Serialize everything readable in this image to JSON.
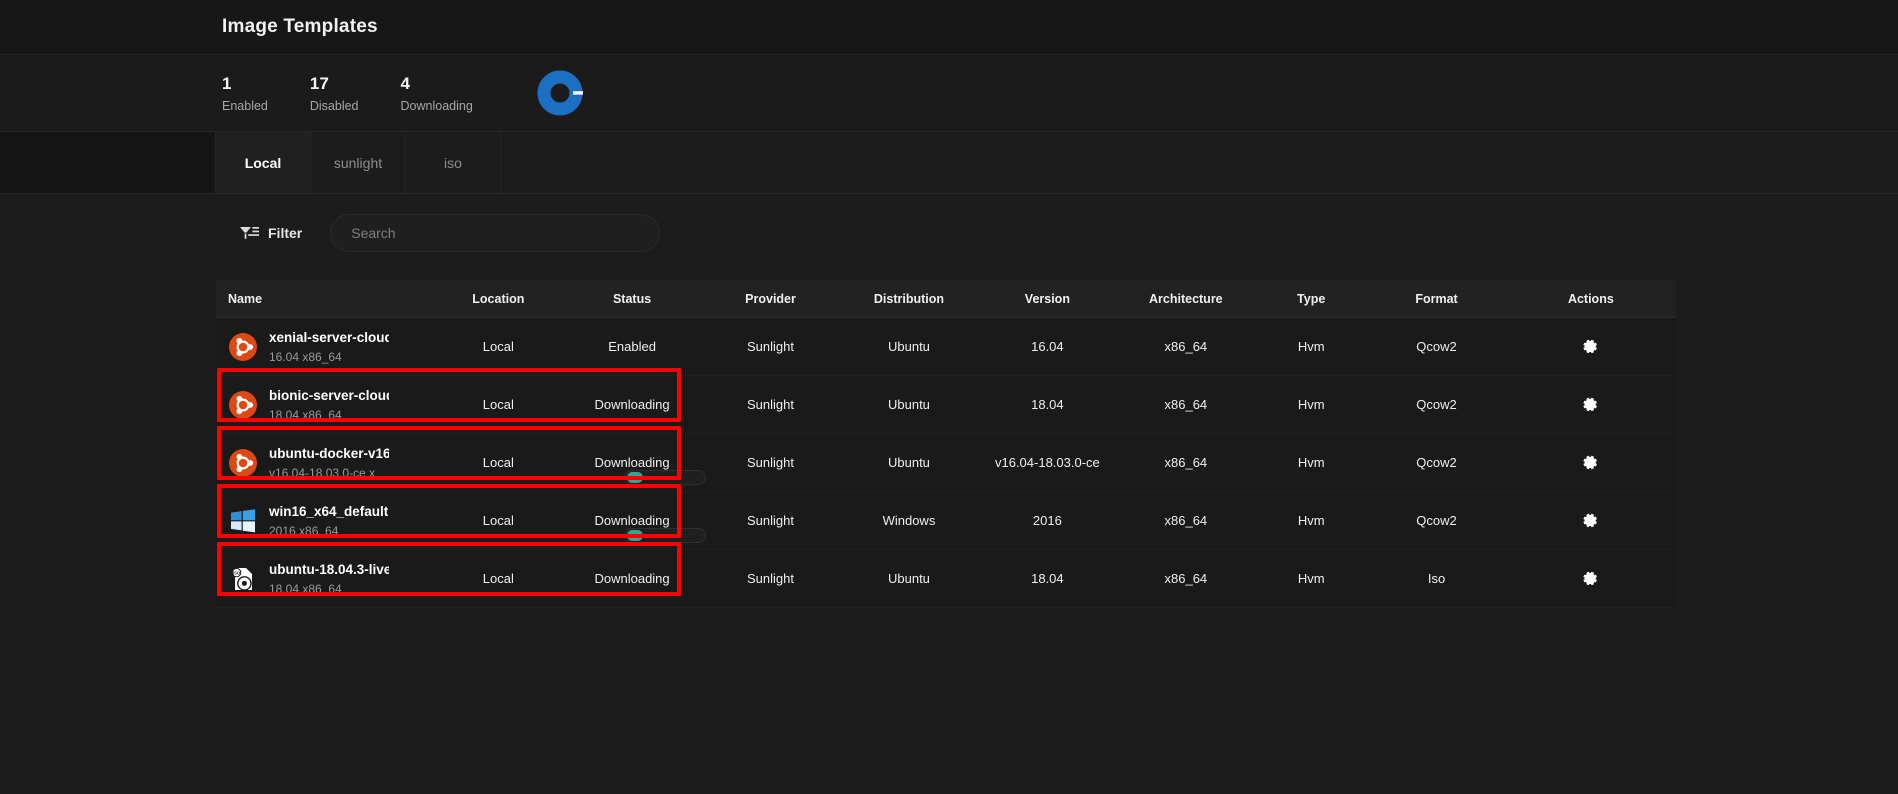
{
  "header": {
    "title": "Image Templates"
  },
  "stats": [
    {
      "num": "1",
      "label": "Enabled",
      "name": "stat-enabled"
    },
    {
      "num": "17",
      "label": "Disabled",
      "name": "stat-disabled"
    },
    {
      "num": "4",
      "label": "Downloading",
      "name": "stat-downloading"
    }
  ],
  "donut": {
    "icon": "donut-chart-icon",
    "color": "#1d6fc4",
    "gap_color": "#ffffff"
  },
  "tabs": [
    {
      "label": "Local",
      "active": true
    },
    {
      "label": "sunlight",
      "active": false
    },
    {
      "label": "iso",
      "active": false
    }
  ],
  "toolbar": {
    "filter_label": "Filter",
    "filter_icon": "filter-funnel-icon",
    "search_placeholder": "Search",
    "search_value": ""
  },
  "table": {
    "columns": [
      "Name",
      "Location",
      "Status",
      "Provider",
      "Distribution",
      "Version",
      "Architecture",
      "Type",
      "Format",
      "Actions"
    ],
    "rows": [
      {
        "icon": "ubuntu-icon",
        "name": "xenial-server-cloud",
        "subtitle": "16.04 x86_64",
        "location": "Local",
        "status": "Enabled",
        "provider": "Sunlight",
        "distribution": "Ubuntu",
        "version": "16.04",
        "architecture": "x86_64",
        "type": "Hvm",
        "format": "Qcow2",
        "action_icon": "gear-icon",
        "progress": false,
        "highlighted": false
      },
      {
        "icon": "ubuntu-icon",
        "name": "bionic-server-cloud",
        "subtitle": "18.04 x86_64",
        "location": "Local",
        "status": "Downloading",
        "provider": "Sunlight",
        "distribution": "Ubuntu",
        "version": "18.04",
        "architecture": "x86_64",
        "type": "Hvm",
        "format": "Qcow2",
        "action_icon": "gear-icon",
        "progress": false,
        "highlighted": true
      },
      {
        "icon": "ubuntu-icon",
        "name": "ubuntu-docker-v16",
        "subtitle": "v16.04-18.03.0-ce x",
        "location": "Local",
        "status": "Downloading",
        "provider": "Sunlight",
        "distribution": "Ubuntu",
        "version": "v16.04-18.03.0-ce",
        "architecture": "x86_64",
        "type": "Hvm",
        "format": "Qcow2",
        "action_icon": "gear-icon",
        "progress": true,
        "progress_percent": 5,
        "highlighted": true
      },
      {
        "icon": "windows-icon",
        "name": "win16_x64_default",
        "subtitle": "2016 x86_64",
        "location": "Local",
        "status": "Downloading",
        "provider": "Sunlight",
        "distribution": "Windows",
        "version": "2016",
        "architecture": "x86_64",
        "type": "Hvm",
        "format": "Qcow2",
        "action_icon": "gear-icon",
        "progress": true,
        "progress_percent": 5,
        "highlighted": true
      },
      {
        "icon": "iso-disc-icon",
        "name": "ubuntu-18.04.3-live",
        "subtitle": "18.04 x86_64",
        "location": "Local",
        "status": "Downloading",
        "provider": "Sunlight",
        "distribution": "Ubuntu",
        "version": "18.04",
        "architecture": "x86_64",
        "type": "Hvm",
        "format": "Iso",
        "action_icon": "gear-icon",
        "progress": false,
        "highlighted": true
      }
    ]
  },
  "annotation": {
    "highlight_color": "#ff0000"
  }
}
